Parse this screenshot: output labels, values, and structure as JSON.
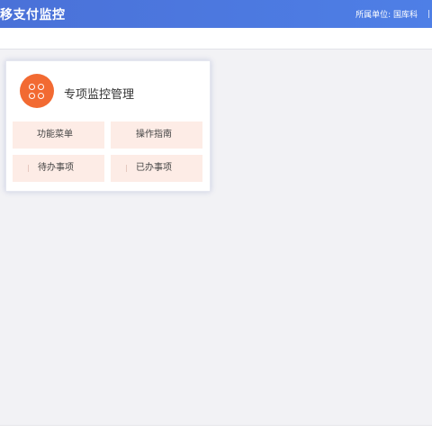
{
  "header": {
    "app_title": "移支付监控",
    "unit_label": "所属单位:",
    "unit_value": "国库科",
    "background_color": "#4a71d8"
  },
  "card": {
    "icon": "apps-icon",
    "icon_color": "#f26a32",
    "title": "专项监控管理",
    "tiles": [
      {
        "label": "功能菜单"
      },
      {
        "label": "操作指南"
      },
      {
        "label": "待办事项"
      },
      {
        "label": "已办事项"
      }
    ]
  }
}
